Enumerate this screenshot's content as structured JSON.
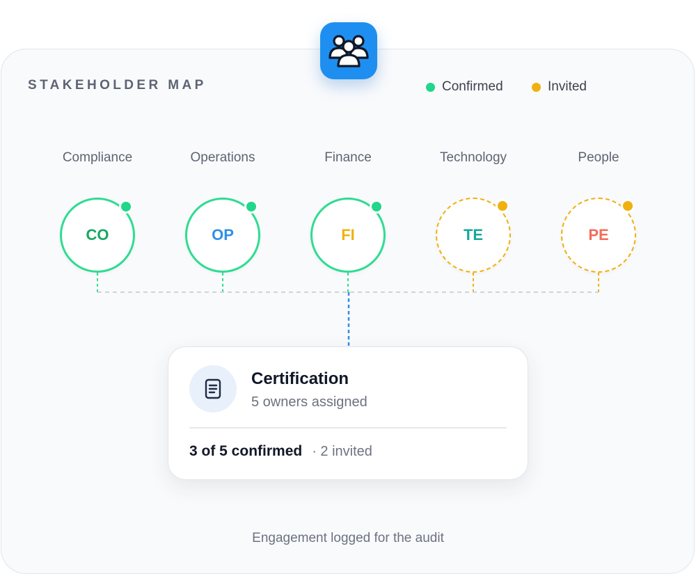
{
  "header": {
    "title": "STAKEHOLDER MAP",
    "badge_icon": "people-group-icon"
  },
  "legend": {
    "confirmed": {
      "label": "Confirmed",
      "color": "#22d68a"
    },
    "invited": {
      "label": "Invited",
      "color": "#f0b10f"
    }
  },
  "stakeholders": [
    {
      "label": "Compliance",
      "initials": "CO",
      "status": "confirmed",
      "initials_color": "#17a85f"
    },
    {
      "label": "Operations",
      "initials": "OP",
      "status": "confirmed",
      "initials_color": "#2f8fe8"
    },
    {
      "label": "Finance",
      "initials": "FI",
      "status": "confirmed",
      "initials_color": "#f0b10f"
    },
    {
      "label": "Technology",
      "initials": "TE",
      "status": "invited",
      "initials_color": "#17a89a"
    },
    {
      "label": "People",
      "initials": "PE",
      "status": "invited",
      "initials_color": "#f26d5b"
    }
  ],
  "card": {
    "icon": "document-icon",
    "title": "Certification",
    "subtitle": "5 owners assigned",
    "confirmed_text": "3 of 5 confirmed",
    "invited_text": "· 2 invited"
  },
  "footer": {
    "note": "Engagement logged for the audit"
  },
  "colors": {
    "accent": "#1e8ff0",
    "confirmed_ring": "#2fdc92",
    "invited_ring": "#f0b10f",
    "connector_grey": "#cfd3da"
  }
}
